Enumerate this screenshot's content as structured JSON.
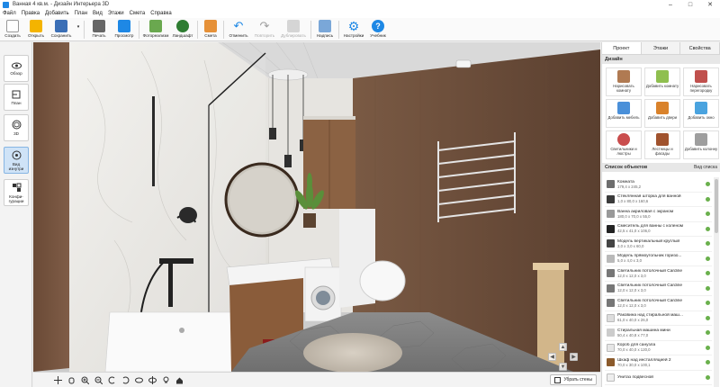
{
  "window": {
    "title": "Ванная 4 кв.м. - Дизайн Интерьера 3D"
  },
  "menu": [
    "Файл",
    "Правка",
    "Добавить",
    "План",
    "Вид",
    "Этажи",
    "Смета",
    "Справка"
  ],
  "toolbar": [
    {
      "label": "Создать",
      "icon": "new-file-icon",
      "color": "#ffffff",
      "disabled": false
    },
    {
      "label": "Открыть",
      "icon": "folder-icon",
      "color": "#f4b400",
      "disabled": false
    },
    {
      "label": "Сохранить",
      "icon": "save-icon",
      "color": "#3b6fb6",
      "disabled": false
    },
    {
      "label": "Печать",
      "icon": "print-icon",
      "color": "#555555",
      "disabled": false
    },
    {
      "label": "Просмотр",
      "icon": "monitor-icon",
      "color": "#1e88e5",
      "disabled": false
    },
    {
      "label": "Фотореализм",
      "icon": "photo-icon",
      "color": "#6aa84f",
      "disabled": false
    },
    {
      "label": "Ландшафт",
      "icon": "landscape-icon",
      "color": "#2e7d32",
      "disabled": false
    },
    {
      "label": "Смета",
      "icon": "estimate-icon",
      "color": "#e69138",
      "disabled": false
    },
    {
      "label": "Отменить",
      "icon": "undo-icon",
      "color": "#1e88e5",
      "disabled": false
    },
    {
      "label": "Повторить",
      "icon": "redo-icon",
      "color": "#9e9e9e",
      "disabled": true
    },
    {
      "label": "Дублировать",
      "icon": "duplicate-icon",
      "color": "#9e9e9e",
      "disabled": true
    },
    {
      "label": "Надпись",
      "icon": "text-label-icon",
      "color": "#7aa7d8",
      "disabled": false
    },
    {
      "label": "Настройки",
      "icon": "gear-icon",
      "color": "#1e88e5",
      "disabled": false
    },
    {
      "label": "Учебник",
      "icon": "help-icon",
      "color": "#1e88e5",
      "disabled": false
    }
  ],
  "left_sidebar": [
    {
      "label": "Обзор",
      "icon": "eye-icon",
      "active": false
    },
    {
      "label": "План",
      "icon": "plan-icon",
      "active": false
    },
    {
      "label": "3D",
      "icon": "cube-3d-icon",
      "active": false
    },
    {
      "label": "Вид изнутри",
      "icon": "inside-view-icon",
      "active": true
    },
    {
      "label": "Конфи-гурации",
      "icon": "configurations-icon",
      "active": false
    }
  ],
  "right_panel": {
    "tabs": [
      "Проект",
      "Этажи",
      "Свойства"
    ],
    "active_tab": "Проект",
    "design_header": "Дизайн",
    "design_items": [
      {
        "label": "Нарисовать комнату",
        "icon": "draw-room-icon",
        "color": "#b07a52"
      },
      {
        "label": "Добавить комнату",
        "icon": "add-room-icon",
        "color": "#8fbf4f"
      },
      {
        "label": "Нарисовать перегородку",
        "icon": "draw-partition-icon",
        "color": "#c0504d"
      },
      {
        "label": "Добавить мебель",
        "icon": "add-furniture-icon",
        "color": "#4a90d9"
      },
      {
        "label": "Добавить двери",
        "icon": "add-door-icon",
        "color": "#d9822b"
      },
      {
        "label": "Добавить окно",
        "icon": "add-window-icon",
        "color": "#4aa3df"
      },
      {
        "label": "Светильники и люстры",
        "icon": "lamp-icon",
        "color": "#c94c4c"
      },
      {
        "label": "Лестницы и фасады",
        "icon": "stairs-icon",
        "color": "#a0522d"
      },
      {
        "label": "Добавить колонну",
        "icon": "add-column-icon",
        "color": "#9e9e9e"
      }
    ],
    "objects_header": "Список объектов",
    "view_list_label": "Вид списка",
    "objects": [
      {
        "name": "Комната",
        "size": "179,4 x 245,2",
        "thumb": "#6d6d6d"
      },
      {
        "name": "Стеклянная шторка для ванной",
        "size": "1,0 x 80,0 x 160,6",
        "thumb": "#3a3a3a"
      },
      {
        "name": "Ванна акриловая с экраном",
        "size": "180,0 x 70,0 x 55,0",
        "thumb": "#999999"
      },
      {
        "name": "Смеситель для ванны с коленом",
        "size": "42,5 x 41,0 x 106,0",
        "thumb": "#222222"
      },
      {
        "name": "Модель вертикальный круглый",
        "size": "3,0 x 3,0 x 60,0",
        "thumb": "#444444"
      },
      {
        "name": "Модель прямоугольник горизо...",
        "size": "5,0 x 4,0 x 3,0",
        "thumb": "#b9b9b9"
      },
      {
        "name": "Светильник потолочный Cardine",
        "size": "12,0 x 12,0 x 3,0",
        "thumb": "#777777"
      },
      {
        "name": "Светильник потолочный Cardine",
        "size": "12,0 x 12,0 x 3,0",
        "thumb": "#777777"
      },
      {
        "name": "Светильник потолочный Cardine",
        "size": "12,0 x 12,0 x 3,0",
        "thumb": "#777777"
      },
      {
        "name": "Раковина над стиральной маш...",
        "size": "61,0 x 40,0 x 26,0",
        "thumb": "#dddddd"
      },
      {
        "name": "Стиральная машина мини",
        "size": "50,4 x 40,8 x 77,0",
        "thumb": "#cccccc"
      },
      {
        "name": "Короб для санузла",
        "size": "70,0 x 40,0 x 120,0",
        "thumb": "#e6e6e6"
      },
      {
        "name": "Шкаф над инсталляцией 2",
        "size": "70,0 x 30,0 x 100,1",
        "thumb": "#8b5a2b"
      },
      {
        "name": "Унитаз подвесной",
        "size": "",
        "thumb": "#eeeeee"
      }
    ]
  },
  "bottom_bar": {
    "icons": [
      "pan-icon",
      "hand-icon",
      "zoom-in-icon",
      "zoom-out-icon",
      "rotate-left-icon",
      "rotate-right-icon",
      "rotate-up-icon",
      "rotate-down-icon",
      "light-icon",
      "home-icon"
    ],
    "hide_walls_label": "Убрать стены"
  },
  "colors": {
    "accent": "#1e88e5",
    "wood": "#6b4a35",
    "marble": "#eceae6",
    "floor": "#7d7d7d"
  }
}
